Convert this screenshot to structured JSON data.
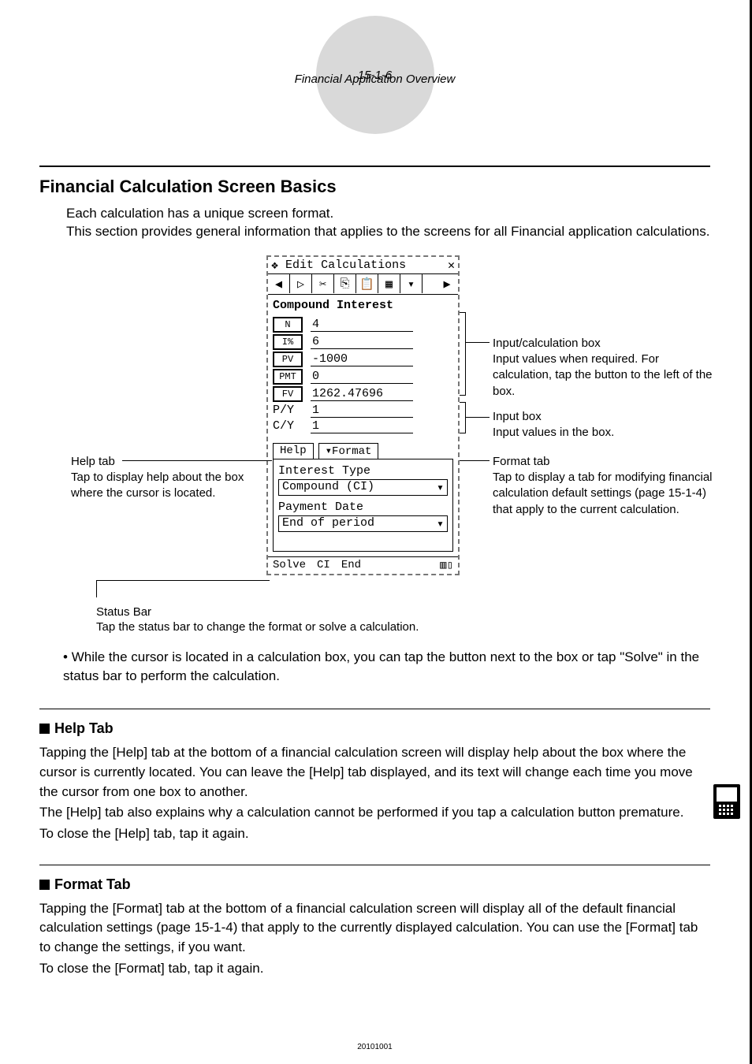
{
  "page_header": {
    "number": "15-1-6",
    "title": "Financial Application Overview"
  },
  "h1": "Financial Calculation Screen Basics",
  "intro": "Each calculation has a unique screen format.\nThis section provides general information that applies to the screens for all Financial application calculations.",
  "screen": {
    "menubar": {
      "menu1": "Edit",
      "menu2": "Calculations",
      "close": "✕"
    },
    "toolbar_icons": [
      "left",
      "right",
      "cut",
      "copy",
      "paste",
      "grid",
      "down",
      "more"
    ],
    "title": "Compound Interest",
    "fields": [
      {
        "btn": "N",
        "val": "4"
      },
      {
        "btn": "I%",
        "val": "6"
      },
      {
        "btn": "PV",
        "val": "-1000"
      },
      {
        "btn": "PMT",
        "val": "0"
      },
      {
        "btn": "FV",
        "val": "1262.47696"
      }
    ],
    "plain_fields": [
      {
        "label": "P/Y",
        "val": "1"
      },
      {
        "label": "C/Y",
        "val": "1"
      }
    ],
    "tabs": {
      "help": "Help",
      "format": "▾Format"
    },
    "tabbox": {
      "row1_label": "Interest Type",
      "row1_value": "Compound (CI)",
      "row2_label": "Payment Date",
      "row2_value": "End of period"
    },
    "status": {
      "s1": "Solve",
      "s2": "CI",
      "s3": "End"
    }
  },
  "callouts": {
    "help_tab_head": "Help tab",
    "help_tab_body": "Tap to display help about the box where the cursor is located.",
    "input_calc_head": "Input/calculation box",
    "input_calc_body": "Input values when required. For calculation, tap the button to the left of the box.",
    "input_head": "Input box",
    "input_body": "Input values in the box.",
    "format_head": "Format tab",
    "format_body": "Tap to display a tab for modifying financial calculation default settings (page 15-1-4) that apply to the current calculation.",
    "status_head": "Status Bar",
    "status_body": "Tap the status bar to change the format or solve a calculation."
  },
  "bullet": "While the cursor is located in a calculation box, you can tap the button next to the box or tap \"Solve\" in the status bar to perform the calculation.",
  "help_section": {
    "title": "Help Tab",
    "p1": "Tapping the [Help] tab at the bottom of a financial calculation screen will display help about the box where the cursor is currently located. You can leave the [Help] tab displayed, and its text will change each time you move the cursor from one box to another.",
    "p2": "The [Help] tab also explains why a calculation cannot be performed if you tap a calculation button premature.",
    "p3": "To close the [Help] tab, tap it again."
  },
  "format_section": {
    "title": "Format Tab",
    "p1": "Tapping the [Format] tab at the bottom of a financial calculation screen will display all of the default financial calculation settings (page 15-1-4) that apply to the currently displayed calculation. You can use the [Format] tab to change the settings, if you want.",
    "p2": "To close the [Format] tab, tap it again."
  },
  "footer": "20101001"
}
